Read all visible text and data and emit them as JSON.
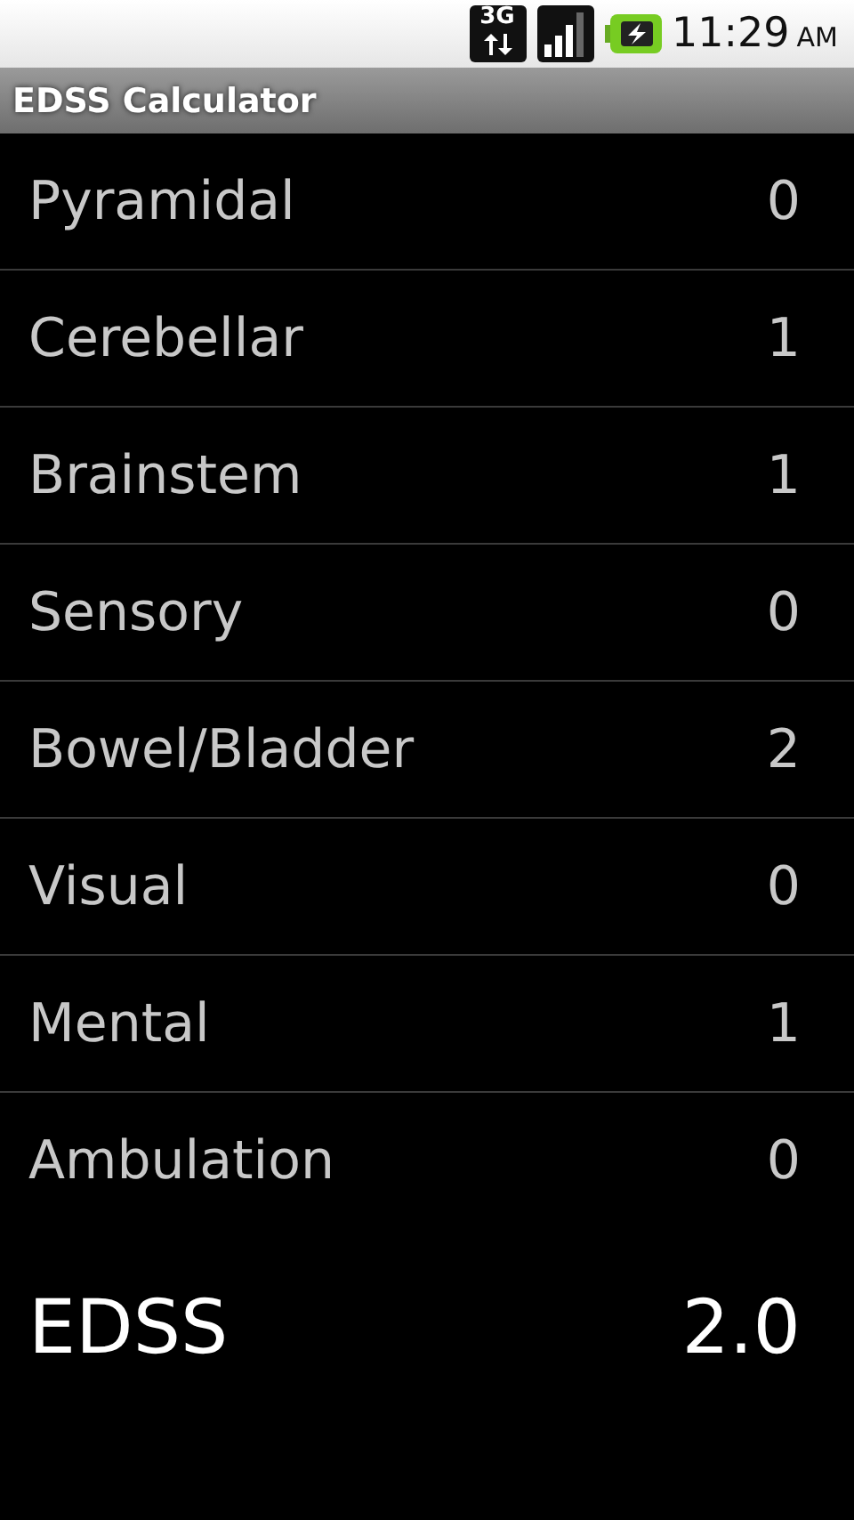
{
  "status_bar": {
    "network": "3G",
    "time": "11:29",
    "meridiem": "AM"
  },
  "window": {
    "title": "EDSS Calculator"
  },
  "systems": [
    {
      "name": "Pyramidal",
      "score": "0"
    },
    {
      "name": "Cerebellar",
      "score": "1"
    },
    {
      "name": "Brainstem",
      "score": "1"
    },
    {
      "name": "Sensory",
      "score": "0"
    },
    {
      "name": "Bowel/Bladder",
      "score": "2"
    },
    {
      "name": "Visual",
      "score": "0"
    },
    {
      "name": "Mental",
      "score": "1"
    },
    {
      "name": "Ambulation",
      "score": "0"
    }
  ],
  "result": {
    "label": "EDSS",
    "value": "2.0"
  }
}
